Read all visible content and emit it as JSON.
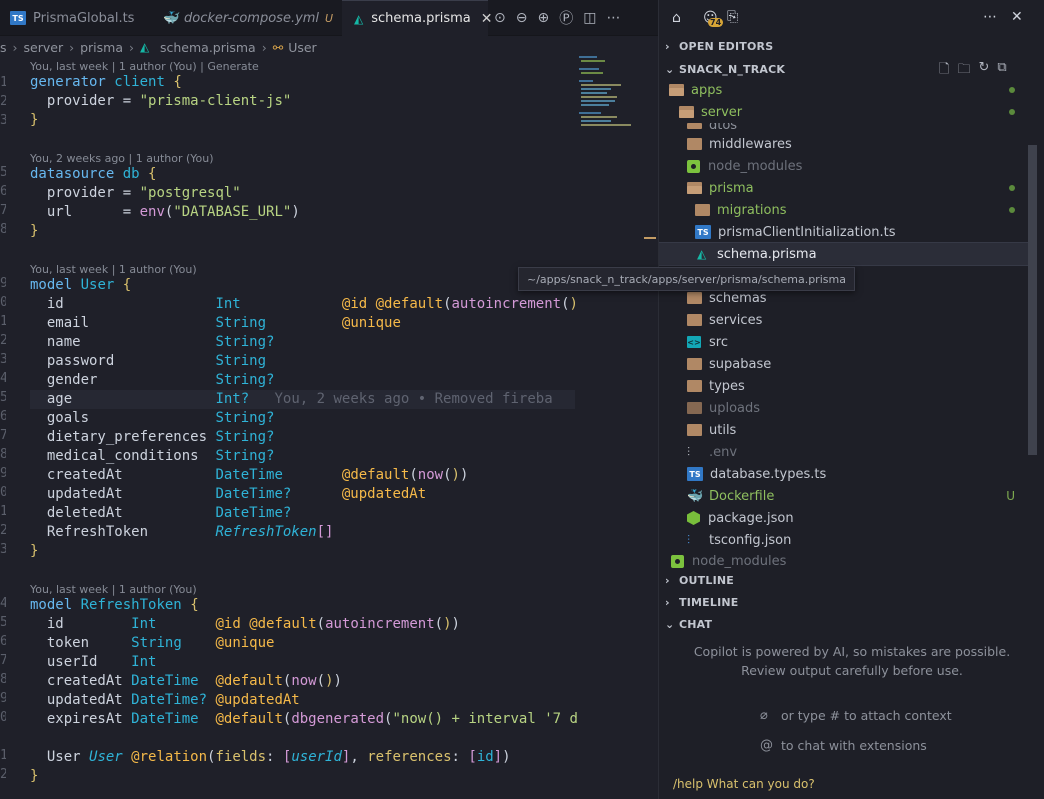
{
  "tabs": [
    {
      "label": "PrismaGlobal.ts",
      "icon": "ts-icon"
    },
    {
      "label": "docker-compose.yml",
      "icon": "docker-icon",
      "modified": "U"
    },
    {
      "label": "schema.prisma",
      "icon": "prisma-icon",
      "active": true,
      "close": "✕"
    }
  ],
  "breadcrumb": [
    "s",
    "server",
    "prisma",
    "schema.prisma",
    "User"
  ],
  "code": {
    "lens": [
      "You, last week | 1 author (You) | Generate",
      "You, 2 weeks ago | 1 author (You)",
      "You, last week | 1 author (You)",
      "You, last week | 1 author (You)"
    ],
    "line_numbers": [
      "1",
      "2",
      "3",
      "5",
      "6",
      "7",
      "8",
      "9",
      "0",
      "1",
      "2",
      "3",
      "4",
      "5",
      "6",
      "7",
      "8",
      "9",
      "0",
      "1",
      "2",
      "3",
      "4",
      "5",
      "6",
      "7",
      "8",
      "9",
      "0",
      "1",
      "2",
      "3",
      "4",
      "5",
      "6",
      "7"
    ],
    "tokens": {
      "generator": "generator",
      "client": "client",
      "provider": "provider",
      "client_js": "\"prisma-client-js\"",
      "datasource": "datasource",
      "db": "db",
      "postgresql": "\"postgresql\"",
      "url": "url",
      "env": "env",
      "db_url": "\"DATABASE_URL\"",
      "model": "model",
      "user": "User",
      "refresh_token": "RefreshToken",
      "id": "id",
      "email": "email",
      "name": "name",
      "password": "password",
      "gender": "gender",
      "age": "age",
      "goals": "goals",
      "dietary": "dietary_preferences",
      "medical": "medical_conditions",
      "createdAt": "createdAt",
      "updatedAt": "updatedAt",
      "deletedAt": "deletedAt",
      "refreshTokenField": "RefreshToken",
      "token": "token",
      "userId": "userId",
      "expiresAt": "expiresAt",
      "Int": "Int",
      "String": "String",
      "StringOpt": "String?",
      "IntOpt": "Int?",
      "DateTime": "DateTime",
      "DateTimeOpt": "DateTime?",
      "at_id": "@id",
      "at_default": "@default",
      "autoinc": "autoincrement",
      "at_unique": "@unique",
      "now": "now",
      "at_updatedAt": "@updatedAt",
      "dbgenerated": "dbgenerated",
      "interval_str": "\"now() + interval '7 d",
      "at_relation": "@relation",
      "fields": "fields",
      "references": "references",
      "blame": "You, 2 weeks ago • Removed fireba"
    }
  },
  "sidebar": {
    "badge": "74",
    "sections": {
      "open_editors": "OPEN EDITORS",
      "project": "SNACK_N_TRACK",
      "outline": "OUTLINE",
      "timeline": "TIMELINE",
      "chat": "CHAT"
    },
    "tree": [
      {
        "label": "apps",
        "git": "dot"
      },
      {
        "label": "server",
        "git": "dot"
      },
      {
        "label": "dtos"
      },
      {
        "label": "middlewares"
      },
      {
        "label": "node_modules"
      },
      {
        "label": "prisma",
        "git": "dot"
      },
      {
        "label": "migrations",
        "git": "dot"
      },
      {
        "label": "prismaClientInitialization.ts"
      },
      {
        "label": "schema.prisma",
        "selected": true
      },
      {
        "label": "schemas"
      },
      {
        "label": "services"
      },
      {
        "label": "src"
      },
      {
        "label": "supabase"
      },
      {
        "label": "types"
      },
      {
        "label": "uploads"
      },
      {
        "label": "utils"
      },
      {
        "label": ".env"
      },
      {
        "label": "database.types.ts"
      },
      {
        "label": "Dockerfile",
        "git": "U"
      },
      {
        "label": "package.json"
      },
      {
        "label": "tsconfig.json"
      },
      {
        "label": "node_modules"
      }
    ],
    "tooltip": "~/apps/snack_n_track/apps/server/prisma/schema.prisma"
  },
  "chat": {
    "message": "Copilot is powered by AI, so mistakes are possible. Review output carefully before use.",
    "hint_attach": "or type # to attach context",
    "hint_extensions": "to chat with extensions",
    "input": "/help What can you do?"
  },
  "colors": {
    "accent": "#67b8f0",
    "string": "#b8d483",
    "attribute": "#f5b949",
    "git_added": "#5b8a3c"
  }
}
